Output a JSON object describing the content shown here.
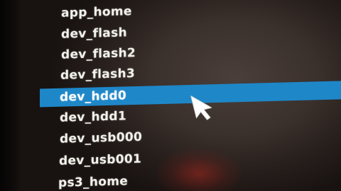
{
  "file_list": {
    "items": [
      {
        "label": "app_home"
      },
      {
        "label": "dev_flash"
      },
      {
        "label": "dev_flash2"
      },
      {
        "label": "dev_flash3"
      },
      {
        "label": "dev_hdd0",
        "selected": true
      },
      {
        "label": "dev_hdd1"
      },
      {
        "label": "dev_usb000"
      },
      {
        "label": "dev_usb001"
      },
      {
        "label": "ps3_home"
      }
    ]
  },
  "colors": {
    "selection": "#1e87c8",
    "text": "#f2f2ea",
    "background": "#3a302c"
  },
  "icons": {
    "cursor": "mouse-pointer-icon"
  }
}
